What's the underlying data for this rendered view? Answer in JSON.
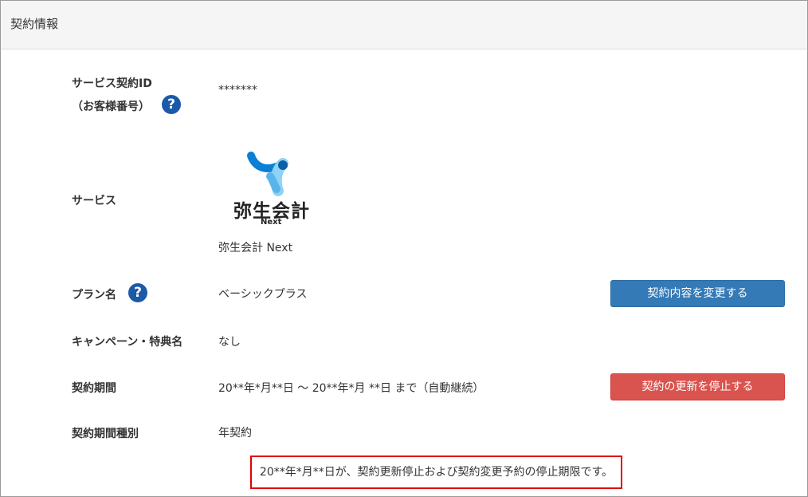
{
  "panel": {
    "title": "契約情報"
  },
  "rows": {
    "service_id": {
      "label_line1": "サービス契約ID",
      "label_line2": "（お客様番号）",
      "value": "*******"
    },
    "service": {
      "label": "サービス",
      "logo_text": "弥生会計",
      "logo_sub": "Next",
      "value": "弥生会計 Next"
    },
    "plan": {
      "label": "プラン名",
      "value": "ベーシックプラス",
      "button": "契約内容を変更する"
    },
    "campaign": {
      "label": "キャンペーン・特典名",
      "value": "なし"
    },
    "period": {
      "label": "契約期間",
      "value": "20**年*月**日 〜 20**年*月 **日 まで（自動継続）",
      "button": "契約の更新を停止する"
    },
    "period_type": {
      "label": "契約期間種別",
      "value": "年契約"
    }
  },
  "notice": "20**年*月**日が、契約更新停止および契約変更予約の停止期限です。",
  "icons": {
    "help": "?"
  },
  "colors": {
    "help_icon": "#1a5aa8",
    "primary_button": "#337ab7",
    "danger_button": "#d9534f",
    "notice_border": "#e00000",
    "logo_blue": "#0b7fd6",
    "logo_light_blue": "#8dd3f5"
  }
}
